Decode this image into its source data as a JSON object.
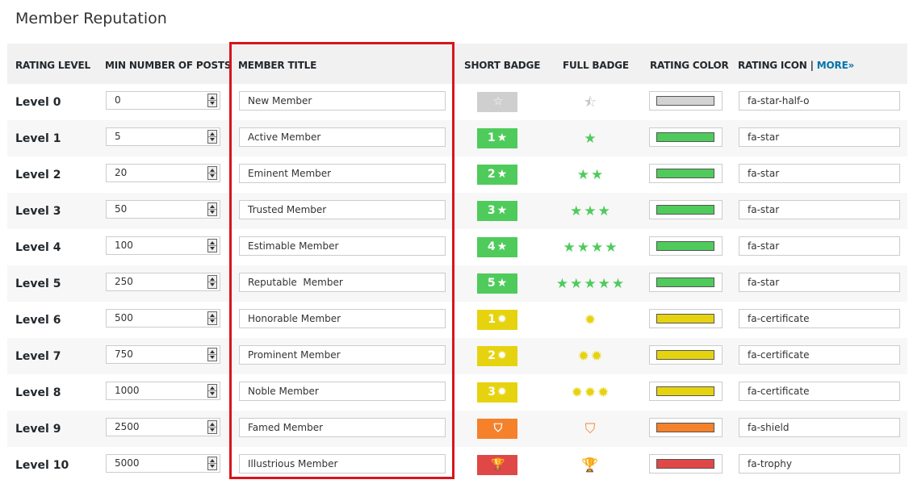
{
  "page": {
    "title": "Member Reputation"
  },
  "headers": {
    "rating_level": "RATING LEVEL",
    "min_posts": "MIN NUMBER OF POSTS",
    "member_title": "MEMBER TITLE",
    "short_badge": "SHORT BADGE",
    "full_badge": "FULL BADGE",
    "rating_color": "RATING COLOR",
    "rating_icon": "RATING ICON |",
    "more": "MORE»"
  },
  "rows": [
    {
      "level": "Level 0",
      "posts": "0",
      "title": "New Member",
      "badge_text": "",
      "badge_glyph": "☆",
      "full": "⯪",
      "color": "#d3d3d3",
      "icon": "fa-star-half-o"
    },
    {
      "level": "Level 1",
      "posts": "5",
      "title": "Active Member",
      "badge_text": "1",
      "badge_glyph": "★",
      "full": "★",
      "color": "#4fcb5c",
      "icon": "fa-star"
    },
    {
      "level": "Level 2",
      "posts": "20",
      "title": "Eminent Member",
      "badge_text": "2",
      "badge_glyph": "★",
      "full": "★★",
      "color": "#4fcb5c",
      "icon": "fa-star"
    },
    {
      "level": "Level 3",
      "posts": "50",
      "title": "Trusted Member",
      "badge_text": "3",
      "badge_glyph": "★",
      "full": "★★★",
      "color": "#4fcb5c",
      "icon": "fa-star"
    },
    {
      "level": "Level 4",
      "posts": "100",
      "title": "Estimable Member",
      "badge_text": "4",
      "badge_glyph": "★",
      "full": "★★★★",
      "color": "#4fcb5c",
      "icon": "fa-star"
    },
    {
      "level": "Level 5",
      "posts": "250",
      "title": "Reputable  Member",
      "badge_text": "5",
      "badge_glyph": "★",
      "full": "★★★★★",
      "color": "#4fcb5c",
      "icon": "fa-star"
    },
    {
      "level": "Level 6",
      "posts": "500",
      "title": "Honorable Member",
      "badge_text": "1",
      "badge_glyph": "✹",
      "full": "✹",
      "color": "#e6d310",
      "icon": "fa-certificate"
    },
    {
      "level": "Level 7",
      "posts": "750",
      "title": "Prominent Member",
      "badge_text": "2",
      "badge_glyph": "✹",
      "full": "✹✹",
      "color": "#e6d310",
      "icon": "fa-certificate"
    },
    {
      "level": "Level 8",
      "posts": "1000",
      "title": "Noble Member",
      "badge_text": "3",
      "badge_glyph": "✹",
      "full": "✹✹✹",
      "color": "#e6d310",
      "icon": "fa-certificate"
    },
    {
      "level": "Level 9",
      "posts": "2500",
      "title": "Famed Member",
      "badge_text": "",
      "badge_glyph": "⛉",
      "full": "⛉",
      "color": "#f5812b",
      "icon": "fa-shield"
    },
    {
      "level": "Level 10",
      "posts": "5000",
      "title": "Illustrious Member",
      "badge_text": "",
      "badge_glyph": "🏆",
      "full": "🏆",
      "color": "#e04747",
      "icon": "fa-trophy"
    }
  ],
  "colors": {
    "gray": "#cfcfcf",
    "green": "#4fcb5c",
    "yellow": "#e6d310",
    "orange": "#f5812b",
    "red": "#e04747",
    "highlight": "#d9141b",
    "link": "#0073aa"
  }
}
